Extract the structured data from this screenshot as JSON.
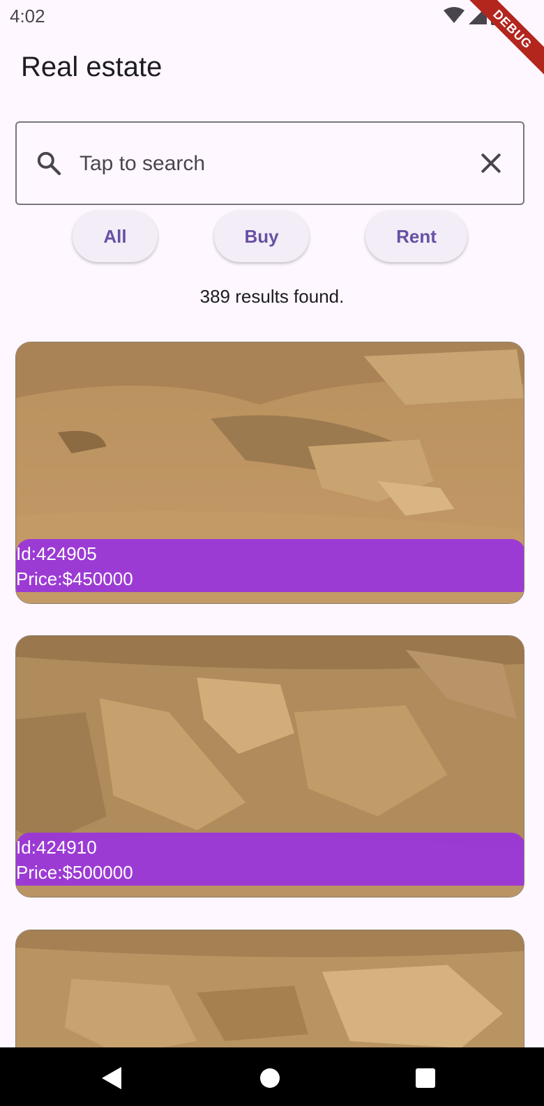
{
  "status_bar": {
    "time": "4:02",
    "debug": "DEBUG"
  },
  "app_bar": {
    "title": "Real estate"
  },
  "search": {
    "placeholder": "Tap to search",
    "value": ""
  },
  "filters": [
    {
      "label": "All"
    },
    {
      "label": "Buy"
    },
    {
      "label": "Rent"
    }
  ],
  "results": {
    "text": "389 results found."
  },
  "listings": [
    {
      "id": "Id:424905",
      "price": "Price:$450000"
    },
    {
      "id": "Id:424910",
      "price": "Price:$500000"
    }
  ],
  "colors": {
    "accent": "#6750a4",
    "label_bg": "#9933dd",
    "background": "#fef7ff"
  }
}
